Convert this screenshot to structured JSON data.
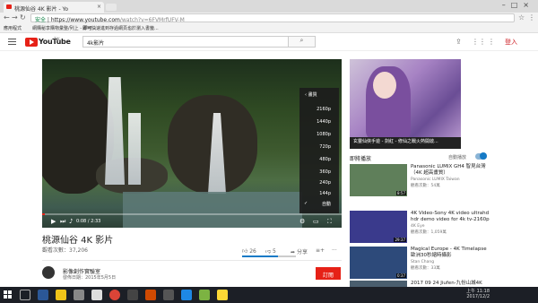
{
  "browser": {
    "tab_title": "桃源仙谷 4K 影片 - Yo",
    "url_secure": "安全",
    "url_host": "https://www.youtube.com",
    "url_path": "/watch?v=6FVMrfUFV-M"
  },
  "bookmarks": [
    "應用程式",
    "網購秘享購物彙整/列上 - 即可...",
    "即可快速進到存過網頁...",
    "也於瀏入書籤..."
  ],
  "youtube": {
    "logo": "YouTube",
    "tw": "TW",
    "search_value": "4k影片",
    "login": "登入"
  },
  "player": {
    "time": "0:08 / 2:33",
    "settings_header": "畫質",
    "qualities": [
      "2160p",
      "1440p",
      "1080p",
      "720p",
      "480p",
      "360p",
      "240p",
      "144p",
      "自動"
    ],
    "selected": "自動"
  },
  "video": {
    "title": "桃源仙谷 4K 影片",
    "views": "觀看次數：37,206",
    "likes": "26",
    "dislikes": "5",
    "share": "分享"
  },
  "channel": {
    "name": "影像創作實驗室",
    "published": "發佈日期：2015年5月5日",
    "subscribe": "訂閱"
  },
  "ad": {
    "caption": "玄靈仙俠手遊 - 劍紅 - 修仙之戰火熱開啟..."
  },
  "upnext": {
    "label": "即將播放",
    "autoplay": "自動播放"
  },
  "videos": [
    {
      "title": "Panasonic LUMIX GH4 智見台灣（4K 超高畫質）",
      "channel": "Panasonic LUMIX Taiwan",
      "views": "觀看次數：54萬",
      "duration": "8:57",
      "thumb": "#5f7f5a"
    },
    {
      "title": "4K Video-Sony 4K video ultrahd hdr demo video for 4k tv-2160p",
      "channel": "4K Eye",
      "views": "觀看次數：1,059萬",
      "duration": "29:37",
      "thumb": "#3a3a8c"
    },
    {
      "title": "Magical Europe - 4K Timelapse 歐洲30秒縮時攝影",
      "channel": "Stan Chang",
      "views": "觀看次數：33萬",
      "duration": "0:37",
      "thumb": "#2d4a7a"
    },
    {
      "title": "2017 09 24 Jiufen-九份山城4K",
      "channel": "",
      "views": "",
      "duration": "",
      "thumb": "#4a5e6e"
    }
  ],
  "taskbar": {
    "time": "上午 11:18",
    "date": "2017/12/2"
  }
}
